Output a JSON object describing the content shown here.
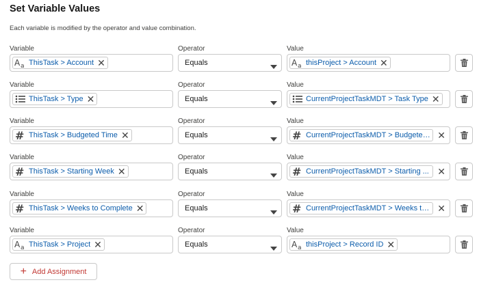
{
  "section": {
    "title": "Set Variable Values",
    "description": "Each variable is modified by the operator and value combination."
  },
  "labels": {
    "variable": "Variable",
    "operator": "Operator",
    "value": "Value"
  },
  "rows": [
    {
      "var_icon": "text-type-icon",
      "var_text": "ThisTask > Account",
      "operator": "Equals",
      "val_icon": "text-type-icon",
      "val_text": "thisProject > Account"
    },
    {
      "var_icon": "picklist-icon",
      "var_text": "ThisTask > Type",
      "operator": "Equals",
      "val_icon": "picklist-icon",
      "val_text": "CurrentProjectTaskMDT > Task Type"
    },
    {
      "var_icon": "number-icon",
      "var_text": "ThisTask > Budgeted Time",
      "operator": "Equals",
      "val_icon": "number-icon",
      "val_text": "CurrentProjectTaskMDT > Budgeted ..."
    },
    {
      "var_icon": "number-icon",
      "var_text": "ThisTask > Starting Week",
      "operator": "Equals",
      "val_icon": "number-icon",
      "val_text": "CurrentProjectTaskMDT > Starting ..."
    },
    {
      "var_icon": "number-icon",
      "var_text": "ThisTask > Weeks to Complete",
      "operator": "Equals",
      "val_icon": "number-icon",
      "val_text": "CurrentProjectTaskMDT > Weeks to ..."
    },
    {
      "var_icon": "text-type-icon",
      "var_text": "ThisTask > Project",
      "operator": "Equals",
      "val_icon": "text-type-icon",
      "val_text": "thisProject > Record ID"
    }
  ],
  "add_assignment": {
    "label": "Add Assignment"
  },
  "colors": {
    "link": "#0b5cab",
    "accent_red": "#c23934",
    "border": "#c9c9c9"
  }
}
